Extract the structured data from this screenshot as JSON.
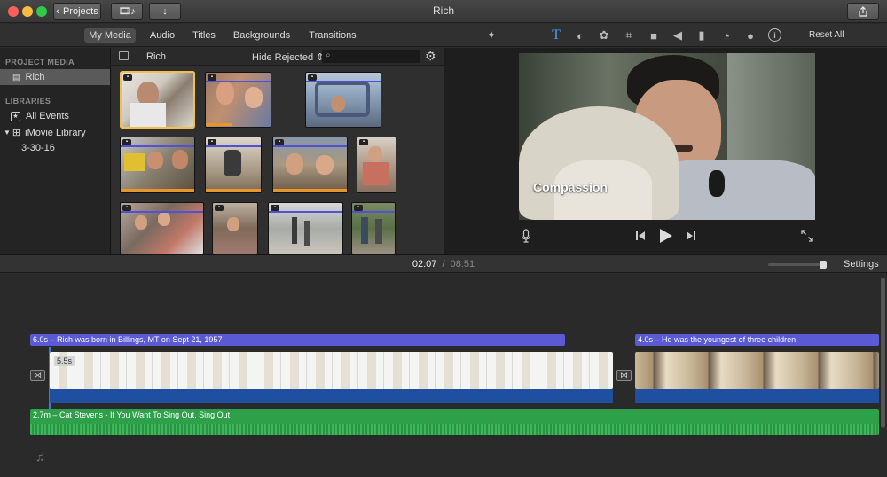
{
  "window": {
    "title": "Rich",
    "projects_label": "Projects"
  },
  "browser_tabs": [
    "My Media",
    "Audio",
    "Titles",
    "Backgrounds",
    "Transitions"
  ],
  "adjust": {
    "reset_label": "Reset All"
  },
  "sidebar": {
    "project_media_header": "PROJECT MEDIA",
    "project_item": "Rich",
    "libraries_header": "LIBRARIES",
    "all_events": "All Events",
    "library": "iMovie Library",
    "event": "3-30-16"
  },
  "browser": {
    "event_name": "Rich",
    "filter": "Hide Rejected",
    "search_value": ""
  },
  "viewer": {
    "caption": "Compassion"
  },
  "timecode": {
    "current": "02:07",
    "separator": "/",
    "total": "08:51",
    "settings_label": "Settings"
  },
  "timeline": {
    "title1": "6.0s – Rich was born in Billings, MT on Sept 21, 1957",
    "title2": "4.0s – He was the youngest of three children",
    "clip1_duration": "5.5s",
    "music": "2.7m – Cat Stevens - If You Want To Sing Out, Sing Out"
  },
  "icons": {
    "back": "chevron-left-icon",
    "media": "film-music-icon",
    "import": "down-arrow-icon",
    "share": "share-icon",
    "enhance": "magic-wand-icon",
    "title": "text-T-icon",
    "color_balance": "color-balance-icon",
    "color_correction": "palette-icon",
    "crop": "crop-icon",
    "stabilization": "camera-icon",
    "volume": "speaker-icon",
    "noise": "equalizer-icon",
    "speed": "speedometer-icon",
    "filter": "circles-icon",
    "info": "info-icon",
    "voiceover": "microphone-icon",
    "fullscreen": "expand-icon"
  },
  "colors": {
    "title_bar": "#5a5ad4",
    "music_bar": "#2ea04a",
    "audio_bar": "#1f4fa0",
    "selection": "#f0c050"
  }
}
